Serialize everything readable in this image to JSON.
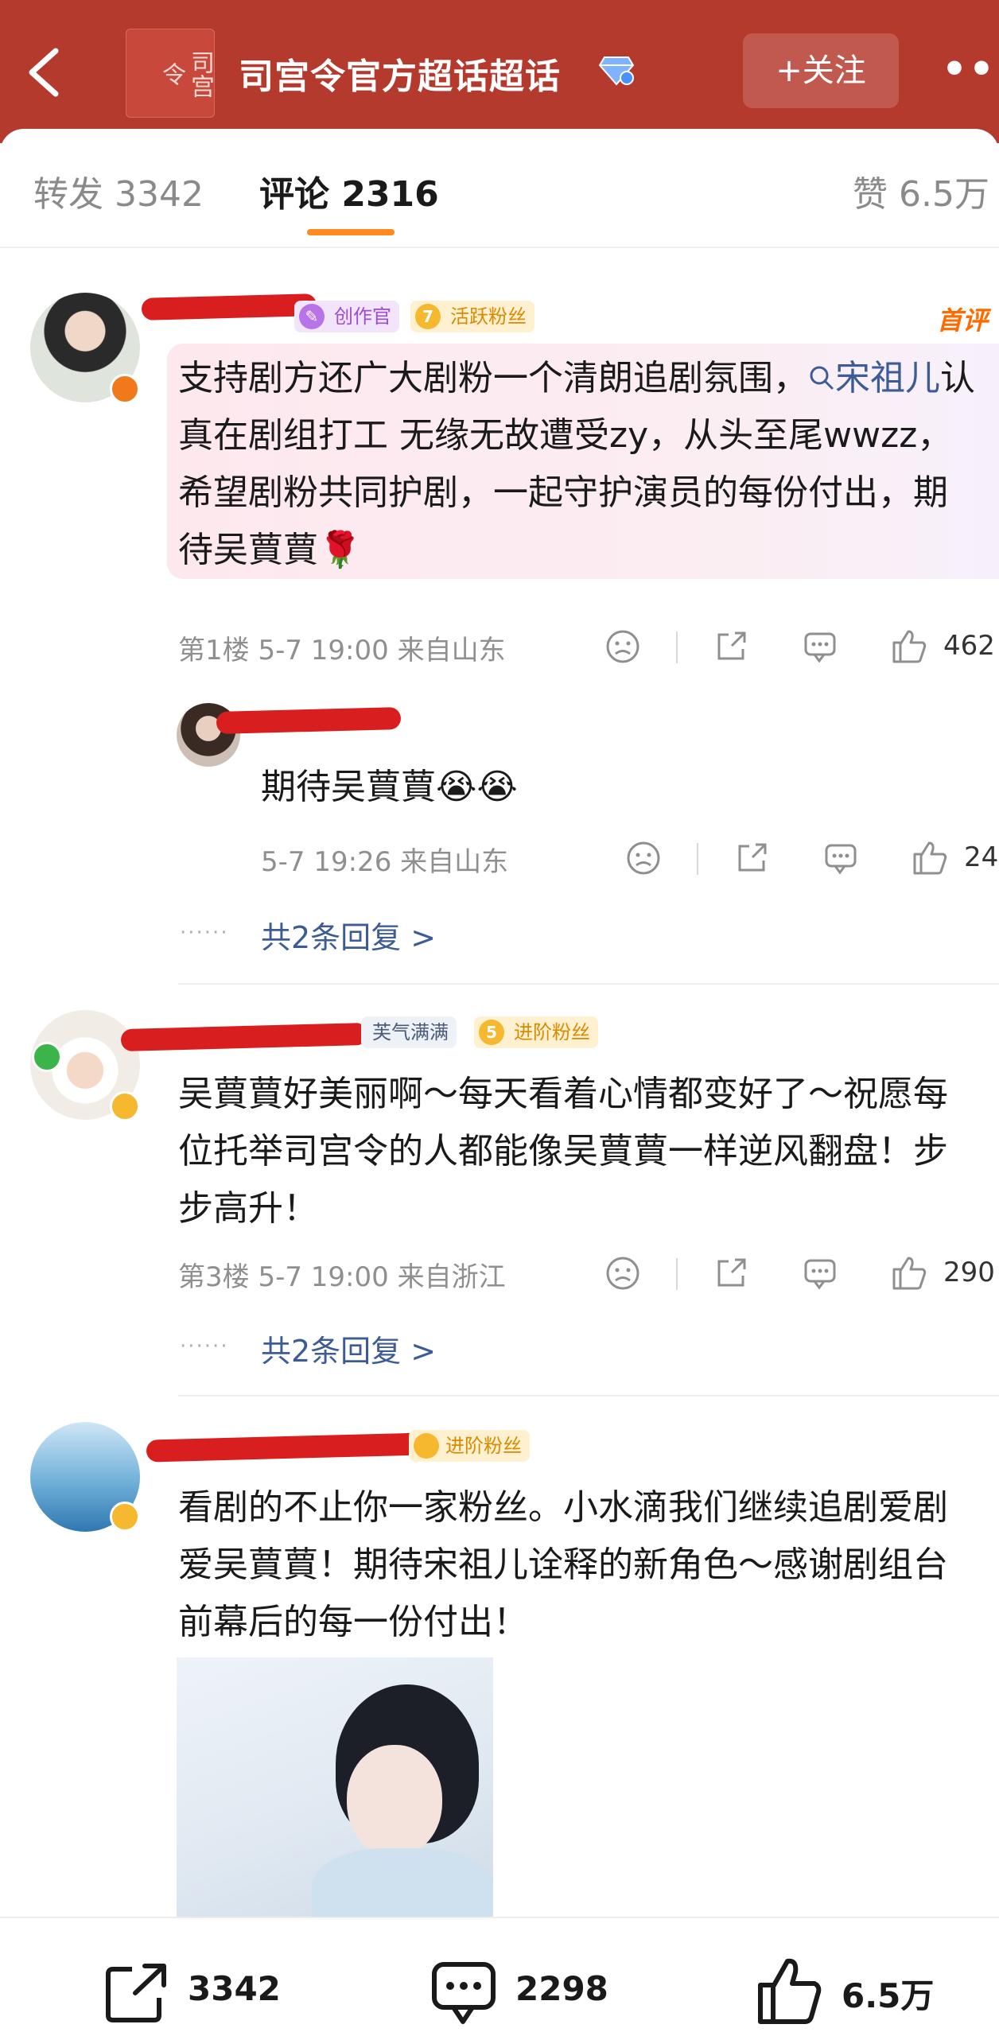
{
  "header": {
    "logo_text": "司宫令",
    "title": "司宫令官方超话超话",
    "follow_label": "+关注",
    "more_label": "•••"
  },
  "tabs": [
    {
      "label": "转发",
      "count": "3342"
    },
    {
      "label": "评论",
      "count": "2316"
    },
    {
      "label": "赞",
      "count": "6.5万"
    }
  ],
  "comments": [
    {
      "badges": [
        {
          "label": "创作官"
        },
        {
          "num": "7",
          "label": "活跃粉丝"
        }
      ],
      "tag": "首评",
      "text_before_link": "支持剧方还广大剧粉一个清朗追剧氛围，",
      "link_text": "宋祖儿",
      "text_after_link": "认真在剧组打工 无缘无故遭受zy，从头至尾wwzz，希望剧粉共同护剧，一起守护演员的每份付出，期待吴蕒蕒🌹",
      "meta": "第1楼 5-7 19:00 来自山东",
      "likes": "462",
      "reply": {
        "text": "期待吴蕒蕒😭😭",
        "meta": "5-7 19:26 来自山东",
        "likes": "24"
      },
      "replies_link": "共2条回复 >"
    },
    {
      "badges": [
        {
          "label": "芙气满满"
        },
        {
          "num": "5",
          "label": "进阶粉丝"
        }
      ],
      "text": "吴蕒蕒好美丽啊～每天看着心情都变好了～祝愿每位托举司宫令的人都能像吴蕒蕒一样逆风翻盘！步步高升！",
      "meta": "第3楼 5-7 19:00 来自浙江",
      "likes": "290",
      "replies_link": "共2条回复 >"
    },
    {
      "badges": [
        {
          "label": "进阶粉丝"
        }
      ],
      "text": "看剧的不止你一家粉丝。小水滴我们继续追剧爱剧爱吴蕒蕒！期待宋祖儿诠释的新角色～感谢剧组台前幕后的每一份付出！"
    }
  ],
  "bottom_bar": {
    "share_count": "3342",
    "comment_count": "2298",
    "like_count": "6.5万"
  },
  "colors": {
    "header_bg": "#b53a2e",
    "accent_orange": "#ff8a1f",
    "link_blue": "#3d5c95",
    "redaction_red": "#d81e1e"
  },
  "icons": [
    "back-arrow-icon",
    "diamond-icon",
    "sad-face-icon",
    "share-icon",
    "comment-icon",
    "thumbs-up-icon",
    "search-icon"
  ]
}
